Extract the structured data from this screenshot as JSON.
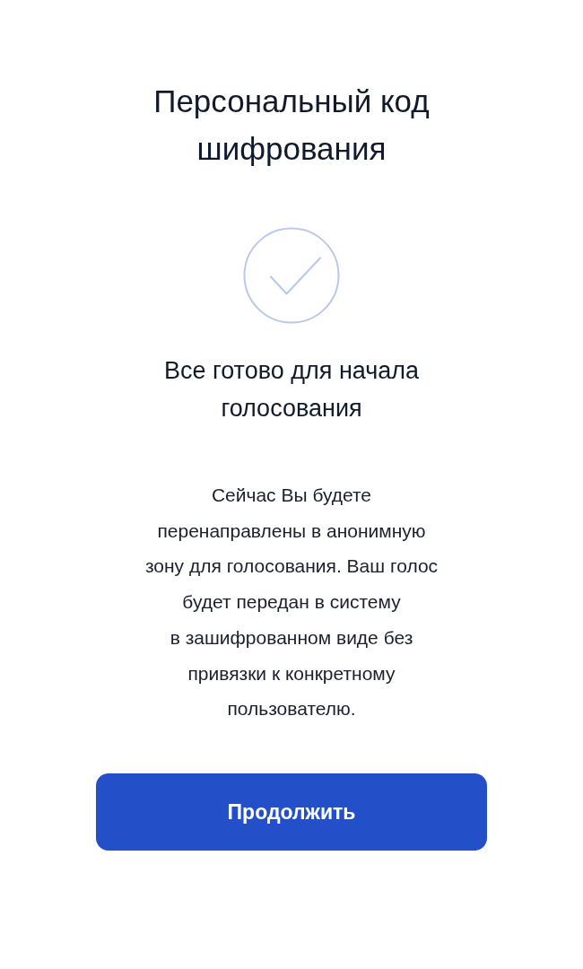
{
  "title": "Персональный код шифрования",
  "subtitle": "Все готово для начала голосования",
  "description": "Сейчас Вы будете\nперенаправлены в анонимную\nзону для голосования. Ваш голос\nбудет передан в систему\nв зашифрованном виде без\nпривязки к конкретному\nпользователю.",
  "button": {
    "label": "Продолжить"
  }
}
